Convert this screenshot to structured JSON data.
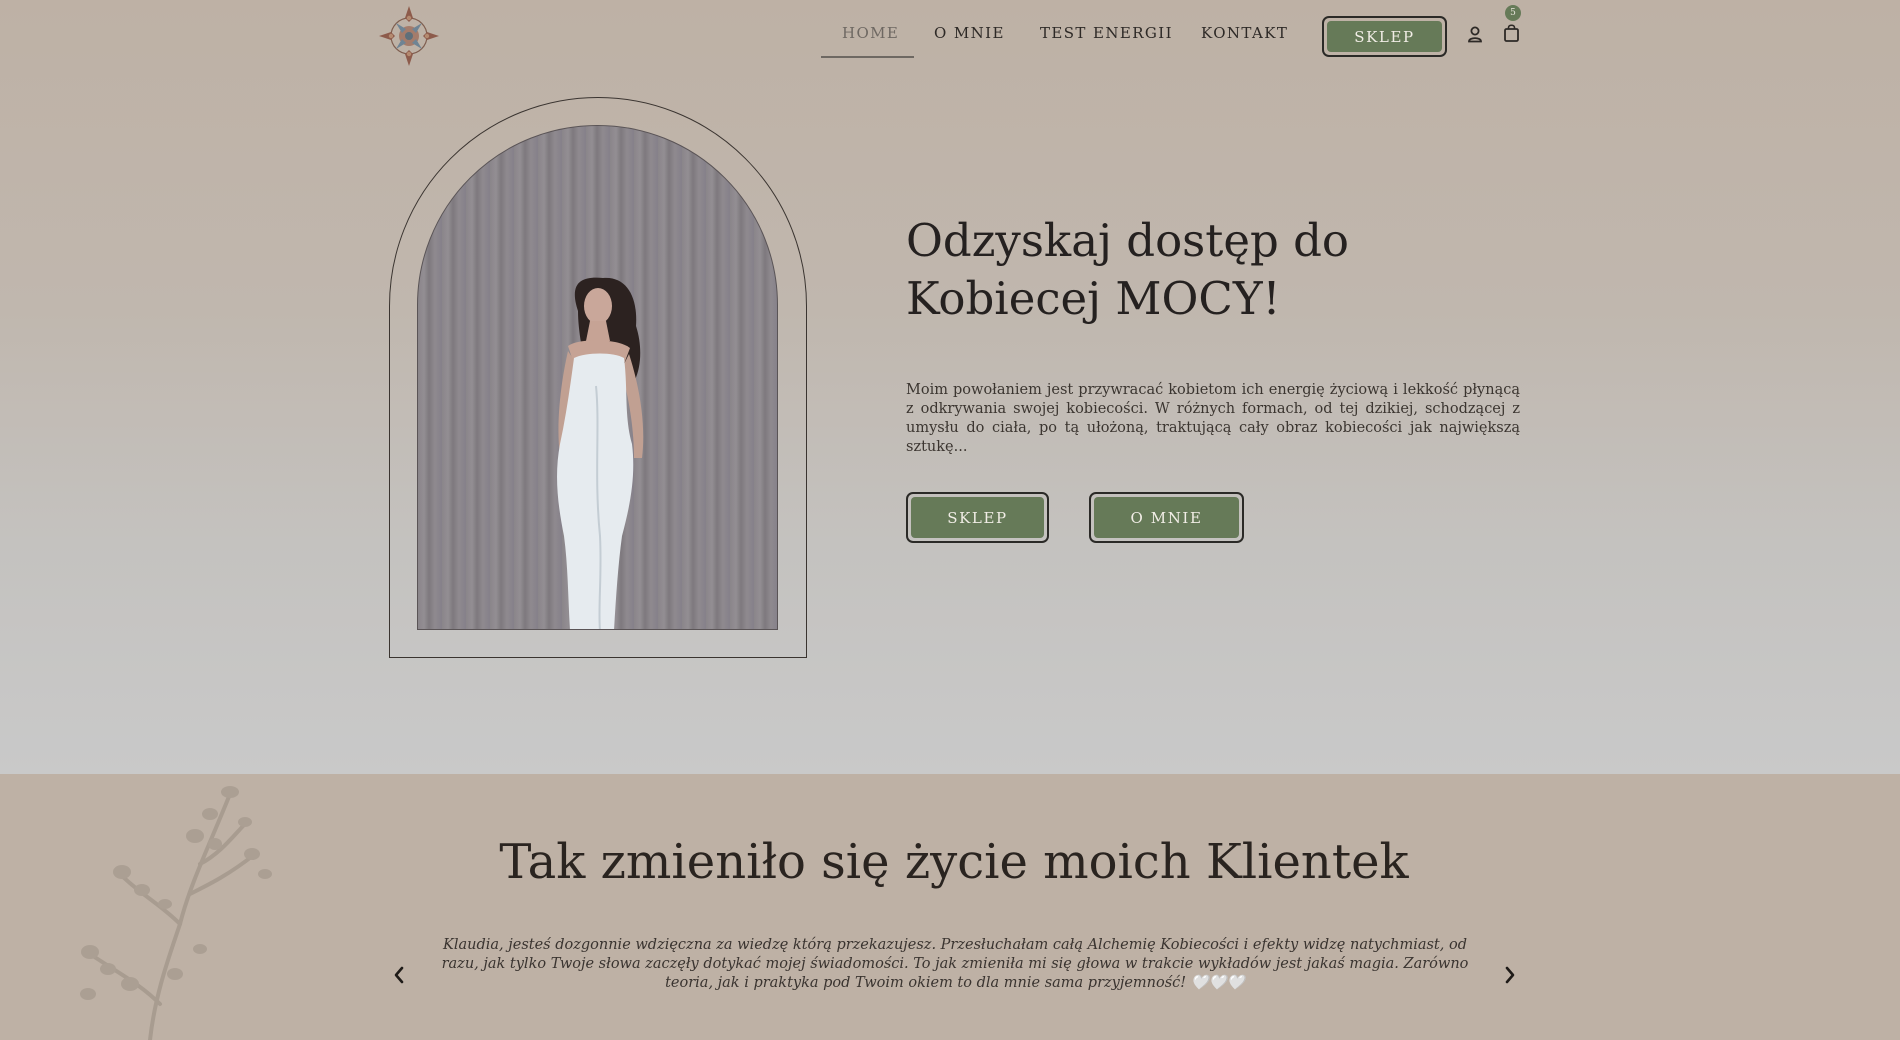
{
  "nav": {
    "items": [
      {
        "label": "HOME",
        "active": true
      },
      {
        "label": "O MNIE"
      },
      {
        "label": "TEST ENERGII"
      },
      {
        "label": "KONTAKT"
      }
    ],
    "shop_button": "SKLEP",
    "cart_count": "5",
    "icons": [
      "logo-mandala-icon",
      "user-icon",
      "shopping-bag-icon"
    ]
  },
  "hero": {
    "title": "Odzyskaj dostęp do Kobiecej MOCY!",
    "text": "Moim powołaniem jest przywracać kobietom ich energię życiową i lekkość płynącą z odkrywania swojej kobiecości. W różnych formach, od tej dzikiej, schodzącej z umysłu do ciała, po tą ułożoną, traktującą cały obraz kobiecości jak największą sztukę...",
    "buttons": {
      "shop": "SKLEP",
      "about": "O MNIE"
    }
  },
  "testimonials": {
    "title": "Tak zmieniło się życie moich Klientek",
    "quote": "Klaudia, jesteś dozgonnie wdzięczna za wiedzę którą przekazujesz. Przesłuchałam całą Alchemię Kobiecości i efekty widzę natychmiast, od razu, jak tylko Twoje słowa zaczęły dotykać mojej świadomości. To jak zmieniła mi się głowa w trakcie wykładów jest jakaś magia. Zarówno teoria, jak i praktyka pod Twoim okiem to dla mnie sama przyjemność! 🤍🤍🤍",
    "icons": [
      "chevron-left-icon",
      "chevron-right-icon"
    ]
  },
  "colors": {
    "accent_green": "#667a58",
    "beige": "#beb1a5",
    "text_dark": "#2a2420"
  }
}
